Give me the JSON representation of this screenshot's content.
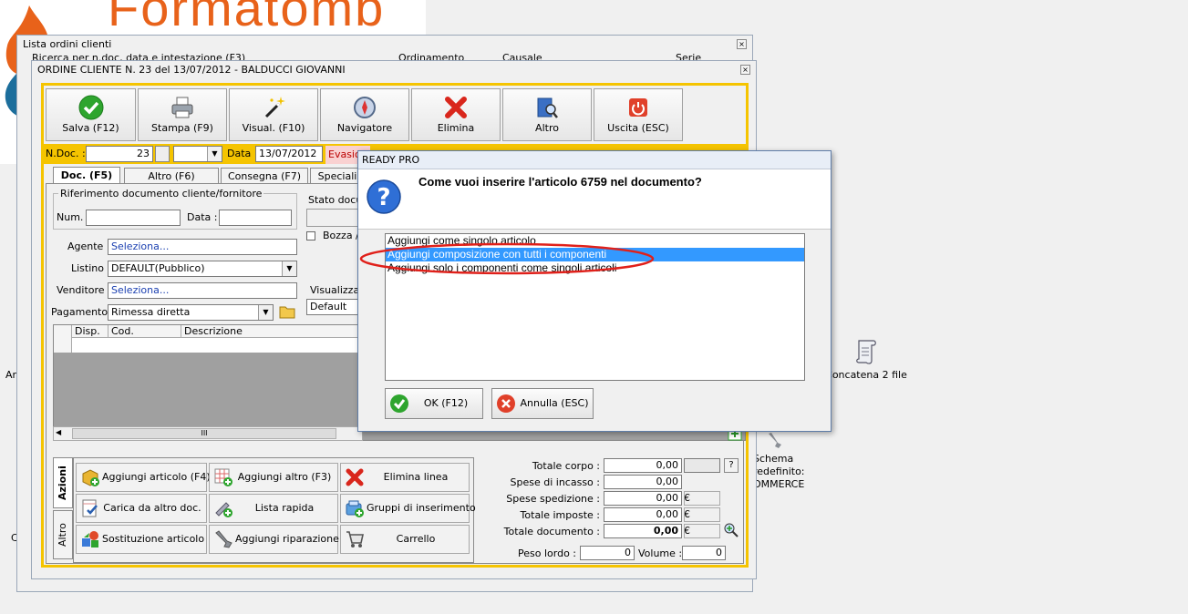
{
  "desktop": {
    "logo_text": "Formatomb",
    "icons": [
      {
        "label": "Concatena 2 file"
      },
      {
        "label": "Schema\nredefinito:\nOMMERCE"
      }
    ],
    "edge_labels": {
      "left_a": "Ar",
      "left_b": "C"
    }
  },
  "outer_window": {
    "title": "Lista ordini clienti",
    "header_fields": [
      "Ricerca per n.doc, data e intestazione (F3)",
      "Ordinamento",
      "Causale",
      "Serie"
    ]
  },
  "order_window": {
    "title": "ORDINE CLIENTE N. 23  del 13/07/2012 - BALDUCCI GIOVANNI",
    "toolbar": [
      {
        "label": "Salva (F12)",
        "icon": "check-icon"
      },
      {
        "label": "Stampa (F9)",
        "icon": "printer-icon"
      },
      {
        "label": "Visual. (F10)",
        "icon": "magic-wand-icon"
      },
      {
        "label": "Navigatore",
        "icon": "compass-icon"
      },
      {
        "label": "Elimina",
        "icon": "red-x-icon"
      },
      {
        "label": "Altro",
        "icon": "book-search-icon"
      },
      {
        "label": "Uscita (ESC)",
        "icon": "power-icon"
      }
    ],
    "ndoc_label": "N.Doc. :",
    "ndoc_value": "23",
    "data_label": "Data :",
    "data_value": "13/07/2012",
    "evasione_label": "Evasion",
    "tabs": [
      "Doc. (F5)",
      "Altro (F6)",
      "Consegna (F7)",
      "Speciali"
    ],
    "riferimento_group": "Riferimento documento cliente/fornitore",
    "num_label": "Num. :",
    "num_value": "",
    "rifdata_label": "Data :",
    "rifdata_value": "",
    "stato_label": "Stato docum",
    "bozza_label": "Bozza /",
    "agente_label": "Agente :",
    "agente_value": "Seleziona...",
    "listino_label": "Listino :",
    "listino_value": "DEFAULT(Pubblico)",
    "venditore_label": "Venditore :",
    "venditore_value": "Seleziona...",
    "pagamento_label": "Pagamento :",
    "pagamento_value": "Rimessa diretta",
    "visualizza_label": "Visualizzazi",
    "visualizza_value": "Default",
    "grid_headers": [
      "Disp.",
      "Cod.",
      "Descrizione"
    ],
    "scroll_grip": "III",
    "side_tabs": [
      "Azioni",
      "Altro"
    ],
    "actions": [
      {
        "label": "Aggiungi articolo (F4)",
        "icon": "box-add-icon"
      },
      {
        "label": "Aggiungi altro (F3)",
        "icon": "grid-add-icon"
      },
      {
        "label": "Elimina linea",
        "icon": "red-x-icon"
      },
      {
        "label": "Carica da altro doc.",
        "icon": "doc-check-icon"
      },
      {
        "label": "Lista rapida",
        "icon": "list-add-icon"
      },
      {
        "label": "Gruppi di inserimento",
        "icon": "group-add-icon"
      },
      {
        "label": "Sostituzione articolo",
        "icon": "shapes-swap-icon"
      },
      {
        "label": "Aggiungi riparazione",
        "icon": "wrench-icon"
      },
      {
        "label": "Carrello",
        "icon": "cart-icon"
      }
    ],
    "totals": [
      {
        "label": "Totale corpo :",
        "value": "0,00",
        "suffix": ""
      },
      {
        "label": "Spese di incasso :",
        "value": "0,00",
        "suffix": ""
      },
      {
        "label": "Spese spedizione :",
        "value": "0,00",
        "suffix": "€"
      },
      {
        "label": "Totale imposte :",
        "value": "0,00",
        "suffix": "€"
      },
      {
        "label": "Totale documento :",
        "value": "0,00",
        "suffix": "€"
      }
    ],
    "help_button": "?",
    "peso_label": "Peso lordo :",
    "peso_value": "0",
    "volume_label": "Volume :",
    "volume_value": "0"
  },
  "dialog": {
    "title": "READY PRO",
    "question": "Come vuoi inserire l'articolo 6759 nel documento?",
    "options": [
      "Aggiungi come singolo articolo",
      "Aggiungi composizione con tutti i componenti",
      "Aggiungi solo i componenti come singoli articoli"
    ],
    "selected_index": 1,
    "ok_label": "OK (F12)",
    "cancel_label": "Annulla (ESC)"
  }
}
